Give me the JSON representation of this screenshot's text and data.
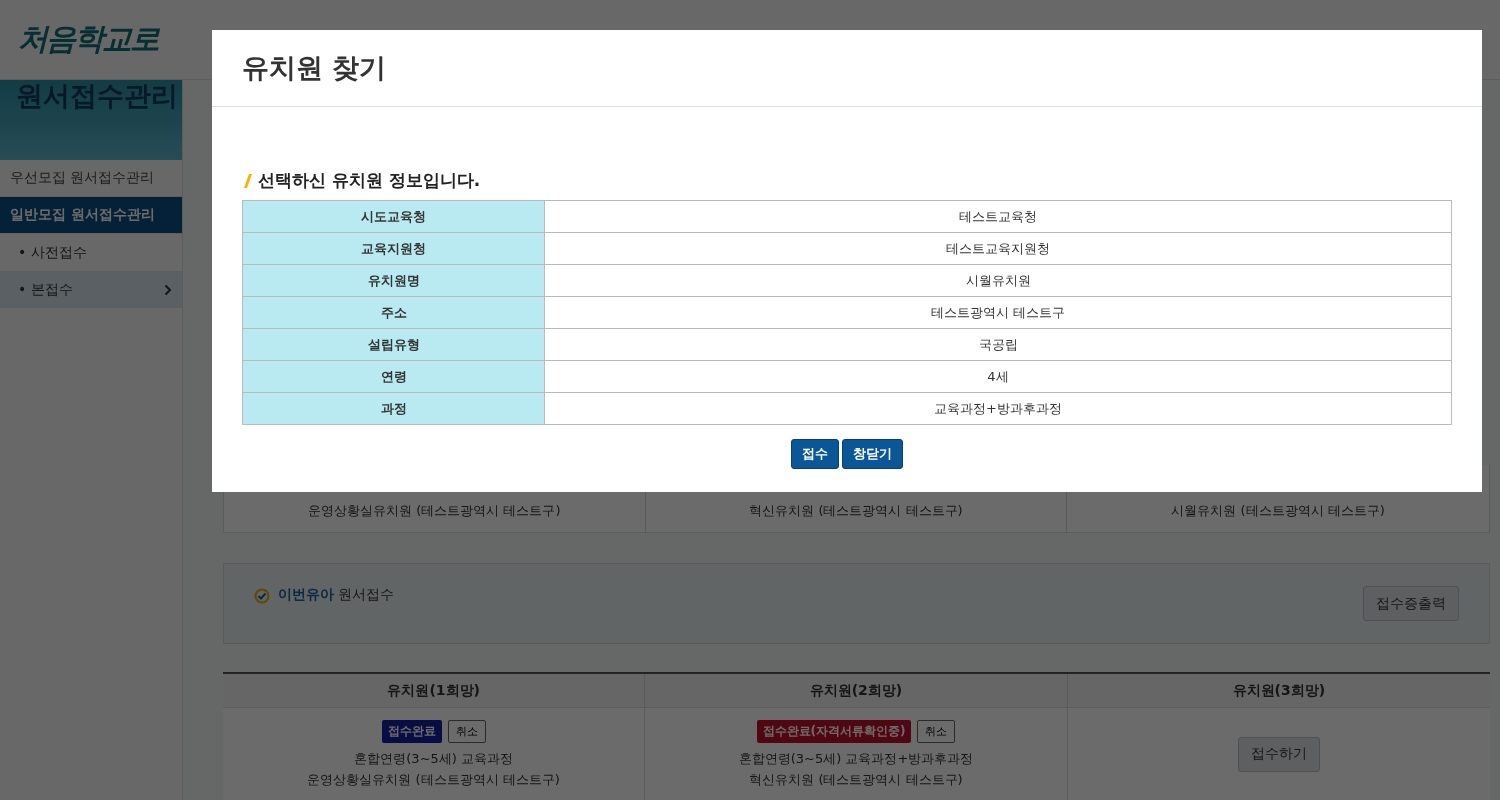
{
  "header": {
    "logo": "처음학교로"
  },
  "sidebar": {
    "banner_title": "원서접수관리",
    "items": [
      {
        "label": "우선모집 원서접수관리",
        "selected": false
      },
      {
        "label": "일반모집 원서접수관리",
        "selected": true,
        "children": [
          {
            "label": "• 사전접수",
            "selected": false
          },
          {
            "label": "• 본접수",
            "selected": true
          }
        ]
      }
    ]
  },
  "upper_table": {
    "cells": [
      "운영상황실유치원 (테스트광역시 테스트구)",
      "혁신유치원 (테스트광역시 테스트구)",
      "시월유치원 (테스트광역시 테스트구)"
    ]
  },
  "section": {
    "title": "**이번유아** 원서접수",
    "button": "접수증출력"
  },
  "applications": {
    "columns": [
      "유치원(1희망)",
      "유치원(2희망)",
      "유치원(3희망)"
    ],
    "cells": [
      {
        "kind": "applied",
        "status": "접수완료",
        "color": "#080d43",
        "cancel": "취소",
        "lines": [
          "혼합연령(3~5세) 교육과정",
          "운영상황실유치원 (테스트광역시 테스트구)"
        ]
      },
      {
        "kind": "applied",
        "status": "접수완료(자격서류확인중)",
        "color": "#510712",
        "cancel": "취소",
        "lines": [
          "혼합연령(3~5세) 교육과정+방과후과정",
          "혁신유치원 (테스트광역시 테스트구)"
        ]
      },
      {
        "kind": "empty",
        "button": "접수하기"
      }
    ]
  },
  "modal": {
    "title": "유치원 찾기",
    "heading": "선택하신 유치원 정보입니다.",
    "rows": [
      {
        "label": "시도교육청",
        "value": "테스트교육청"
      },
      {
        "label": "교육지원청",
        "value": "테스트교육지원청"
      },
      {
        "label": "유치원명",
        "value": "시월유치원"
      },
      {
        "label": "주소",
        "value": "테스트광역시 테스트구"
      },
      {
        "label": "설립유형",
        "value": "국공립"
      },
      {
        "label": "연령",
        "value": "4세"
      },
      {
        "label": "과정",
        "value": "교육과정+방과후과정"
      }
    ],
    "buttons": [
      "접수",
      "창닫기"
    ]
  }
}
